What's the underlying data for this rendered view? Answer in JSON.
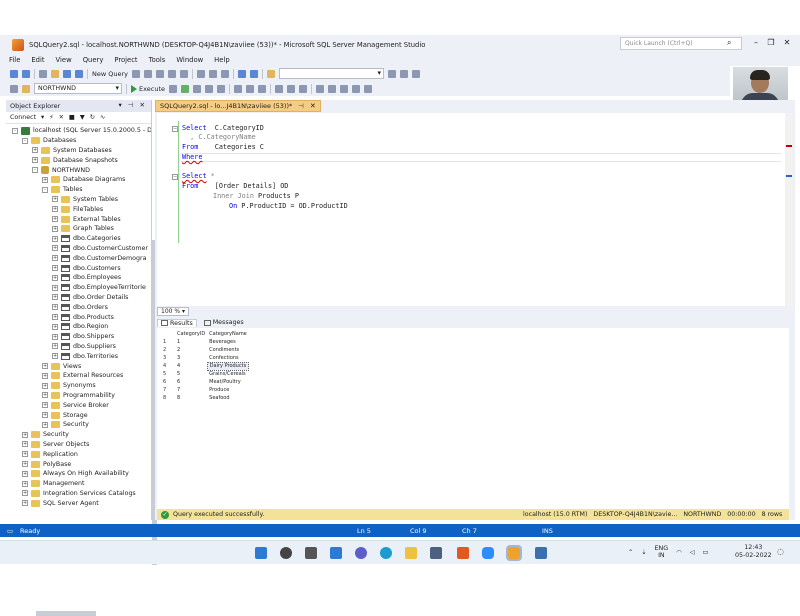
{
  "window": {
    "title": "SQLQuery2.sql - localhost.NORTHWND (DESKTOP-Q4J4B1N\\zaviiee (53))* - Microsoft SQL Server Management Studio",
    "quick_launch_placeholder": "Quick Launch (Ctrl+Q)"
  },
  "menu": [
    "File",
    "Edit",
    "View",
    "Query",
    "Project",
    "Tools",
    "Window",
    "Help"
  ],
  "toolbar": {
    "new_query": "New Query",
    "execute": "Execute",
    "database": "NORTHWND"
  },
  "object_explorer": {
    "title": "Object Explorer",
    "connect": "Connect",
    "tree": [
      {
        "label": "localhost (SQL Server 15.0.2000.5 - D",
        "level": 0,
        "kind": "server",
        "exp": "-"
      },
      {
        "label": "Databases",
        "level": 1,
        "kind": "folder",
        "exp": "-"
      },
      {
        "label": "System Databases",
        "level": 2,
        "kind": "folder",
        "exp": "+"
      },
      {
        "label": "Database Snapshots",
        "level": 2,
        "kind": "folder",
        "exp": "+"
      },
      {
        "label": "NORTHWND",
        "level": 2,
        "kind": "db",
        "exp": "-"
      },
      {
        "label": "Database Diagrams",
        "level": 3,
        "kind": "folder",
        "exp": "+"
      },
      {
        "label": "Tables",
        "level": 3,
        "kind": "folder",
        "exp": "-"
      },
      {
        "label": "System Tables",
        "level": 4,
        "kind": "folder",
        "exp": "+"
      },
      {
        "label": "FileTables",
        "level": 4,
        "kind": "folder",
        "exp": "+"
      },
      {
        "label": "External Tables",
        "level": 4,
        "kind": "folder",
        "exp": "+"
      },
      {
        "label": "Graph Tables",
        "level": 4,
        "kind": "folder",
        "exp": "+"
      },
      {
        "label": "dbo.Categories",
        "level": 4,
        "kind": "table",
        "exp": "+"
      },
      {
        "label": "dbo.CustomerCustomer",
        "level": 4,
        "kind": "table",
        "exp": "+"
      },
      {
        "label": "dbo.CustomerDemogra",
        "level": 4,
        "kind": "table",
        "exp": "+"
      },
      {
        "label": "dbo.Customers",
        "level": 4,
        "kind": "table",
        "exp": "+"
      },
      {
        "label": "dbo.Employees",
        "level": 4,
        "kind": "table",
        "exp": "+"
      },
      {
        "label": "dbo.EmployeeTerritorie",
        "level": 4,
        "kind": "table",
        "exp": "+"
      },
      {
        "label": "dbo.Order Details",
        "level": 4,
        "kind": "table",
        "exp": "+"
      },
      {
        "label": "dbo.Orders",
        "level": 4,
        "kind": "table",
        "exp": "+"
      },
      {
        "label": "dbo.Products",
        "level": 4,
        "kind": "table",
        "exp": "+"
      },
      {
        "label": "dbo.Region",
        "level": 4,
        "kind": "table",
        "exp": "+"
      },
      {
        "label": "dbo.Shippers",
        "level": 4,
        "kind": "table",
        "exp": "+"
      },
      {
        "label": "dbo.Suppliers",
        "level": 4,
        "kind": "table",
        "exp": "+"
      },
      {
        "label": "dbo.Territories",
        "level": 4,
        "kind": "table",
        "exp": "+"
      },
      {
        "label": "Views",
        "level": 3,
        "kind": "folder",
        "exp": "+"
      },
      {
        "label": "External Resources",
        "level": 3,
        "kind": "folder",
        "exp": "+"
      },
      {
        "label": "Synonyms",
        "level": 3,
        "kind": "folder",
        "exp": "+"
      },
      {
        "label": "Programmability",
        "level": 3,
        "kind": "folder",
        "exp": "+"
      },
      {
        "label": "Service Broker",
        "level": 3,
        "kind": "folder",
        "exp": "+"
      },
      {
        "label": "Storage",
        "level": 3,
        "kind": "folder",
        "exp": "+"
      },
      {
        "label": "Security",
        "level": 3,
        "kind": "folder",
        "exp": "+"
      },
      {
        "label": "Security",
        "level": 1,
        "kind": "folder",
        "exp": "+"
      },
      {
        "label": "Server Objects",
        "level": 1,
        "kind": "folder",
        "exp": "+"
      },
      {
        "label": "Replication",
        "level": 1,
        "kind": "folder",
        "exp": "+"
      },
      {
        "label": "PolyBase",
        "level": 1,
        "kind": "folder",
        "exp": "+"
      },
      {
        "label": "Always On High Availability",
        "level": 1,
        "kind": "folder",
        "exp": "+"
      },
      {
        "label": "Management",
        "level": 1,
        "kind": "folder",
        "exp": "+"
      },
      {
        "label": "Integration Services Catalogs",
        "level": 1,
        "kind": "folder",
        "exp": "+"
      },
      {
        "label": "SQL Server Agent",
        "level": 1,
        "kind": "folder",
        "exp": "+"
      }
    ]
  },
  "editor": {
    "tab_title": "SQLQuery2.sql - lo...J4B1N\\zaviiee (53))*",
    "lines": {
      "l1_kw": "Select",
      "l1_rest": "  C.CategoryID",
      "l2": "  , C.CategoryName",
      "l3_kw": "From",
      "l3_rest": "    Categories C",
      "l4_kw": "Where",
      "l5_kw": "Select",
      "l5_rest": " *",
      "l6_kw": "From",
      "l6_rest": "    [Order Details] OD",
      "l7_gr": "Inner Join",
      "l7_rest": " Products P",
      "l8_kw": "On",
      "l8_rest": " P.ProductID = OD.ProductID"
    }
  },
  "zoom": "100 %",
  "results": {
    "tab_results": "Results",
    "tab_messages": "Messages",
    "columns": [
      "CategoryID",
      "CategoryName"
    ],
    "rows": [
      [
        "1",
        "1",
        "Beverages"
      ],
      [
        "2",
        "2",
        "Condiments"
      ],
      [
        "3",
        "3",
        "Confections"
      ],
      [
        "4",
        "4",
        "Dairy Products"
      ],
      [
        "5",
        "5",
        "Grains/Cereals"
      ],
      [
        "6",
        "6",
        "Meat/Poultry"
      ],
      [
        "7",
        "7",
        "Produce"
      ],
      [
        "8",
        "8",
        "Seafood"
      ]
    ]
  },
  "query_status": {
    "message": "Query executed successfully.",
    "server": "localhost (15.0 RTM)",
    "user": "DESKTOP-Q4J4B1N\\zavie...",
    "database": "NORTHWND",
    "time": "00:00:00",
    "rows": "8 rows"
  },
  "statusbar": {
    "ready": "Ready",
    "ln": "Ln 5",
    "col": "Col 9",
    "ch": "Ch 7",
    "ins": "INS"
  },
  "tray": {
    "lang1": "ENG",
    "lang2": "IN",
    "time": "12:43",
    "date": "05-02-2022"
  }
}
